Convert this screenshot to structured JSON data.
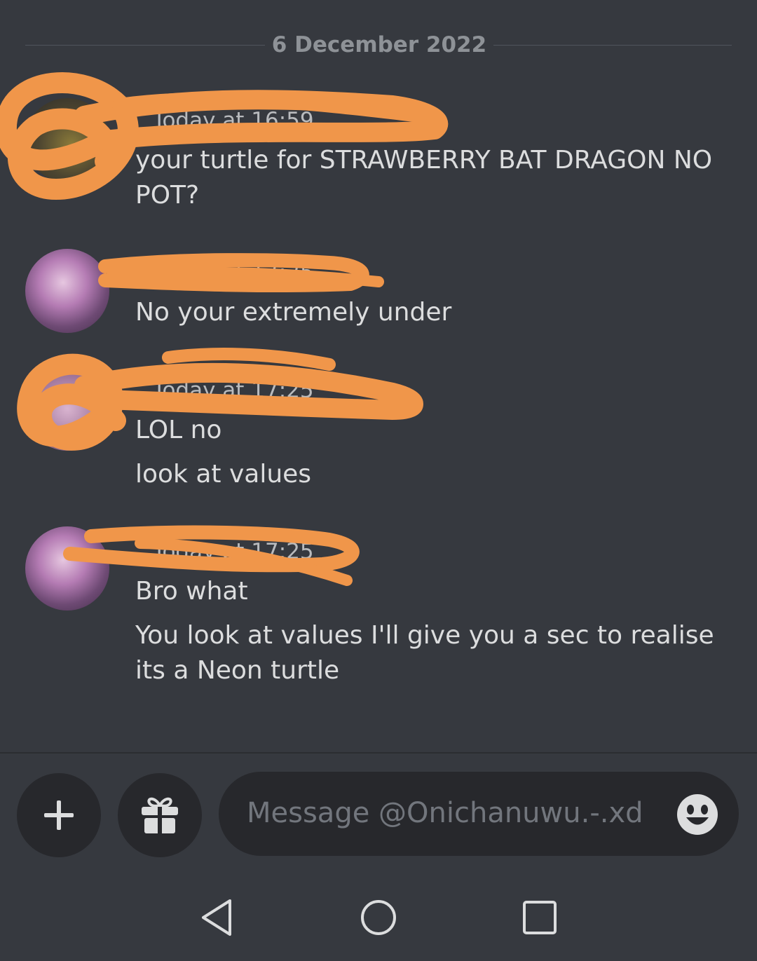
{
  "date_divider": "6 December 2022",
  "messages": [
    {
      "timestamp": "Today at 16:59",
      "lines": [
        "your turtle for STRAWBERRY BAT DRAGON NO POT?"
      ]
    },
    {
      "timestamp": "Today at 17:25",
      "lines": [
        "No your extremely under"
      ]
    },
    {
      "timestamp": "Today at 17:25",
      "lines": [
        "LOL no",
        "look at values"
      ]
    },
    {
      "timestamp": "Today at 17:25",
      "lines": [
        "Bro what",
        "You look at values I'll give you a sec to realise its a Neon turtle"
      ]
    }
  ],
  "composer": {
    "placeholder": "Message @Onichanuwu.-.xd",
    "add_icon": "plus-icon",
    "gift_icon": "gift-icon",
    "emoji_icon": "smile-emoji-icon"
  },
  "navbar": {
    "back_icon": "triangle-back-icon",
    "home_icon": "circle-home-icon",
    "recent_icon": "square-recent-icon"
  },
  "colors": {
    "background": "#36393f",
    "scribble": "#f0964a",
    "input_bg": "#27282c"
  }
}
